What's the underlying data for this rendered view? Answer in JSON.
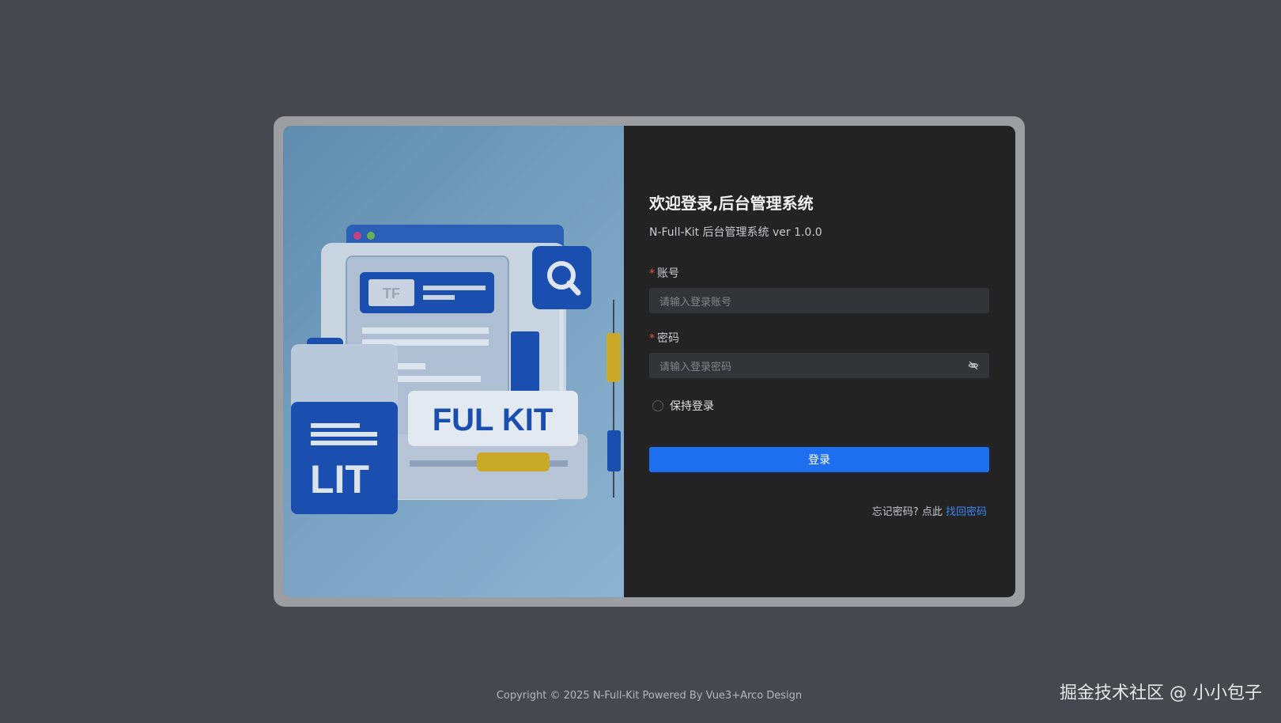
{
  "login": {
    "title": "欢迎登录,后台管理系统",
    "subtitle": "N-Full-Kit 后台管理系统 ver 1.0.0",
    "account": {
      "required_mark": "*",
      "label": "账号",
      "placeholder": "请输入登录账号"
    },
    "password": {
      "required_mark": "*",
      "label": "密码",
      "placeholder": "请输入登录密码",
      "visibility_icon": "eye-off-icon"
    },
    "remember_label": "保持登录",
    "remember_checked": false,
    "submit_label": "登录",
    "forgot_prefix": "忘记密码? 点此",
    "forgot_link": "找回密码"
  },
  "illustration": {
    "logo_text": "FUL KIT",
    "side_text": "LIT",
    "tag_text": "TF"
  },
  "footer": {
    "copyright": "Copyright © 2025 N-Full-Kit Powered By Vue3+Arco Design"
  },
  "watermark": "掘金技术社区 @ 小小包子",
  "colors": {
    "page_bg": "#47484d",
    "panel_bg": "#232324",
    "input_bg": "#333437",
    "accent": "#1e6ff0",
    "link": "#3c86f5",
    "required": "#e8534f"
  }
}
